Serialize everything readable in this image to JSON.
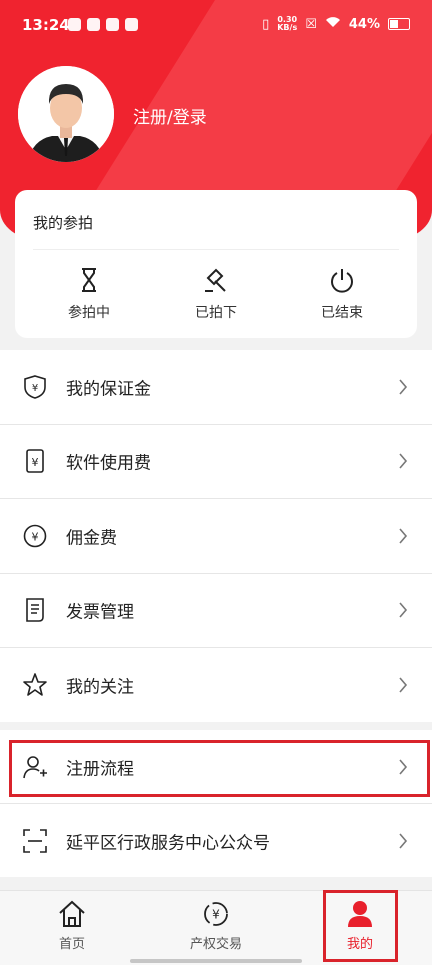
{
  "status_bar": {
    "time": "13:24",
    "speed_value": "0.30",
    "speed_unit": "KB/s",
    "battery": "44%"
  },
  "profile": {
    "login_label": "注册/登录"
  },
  "auction": {
    "title": "我的参拍",
    "items": [
      {
        "label": "参拍中",
        "icon": "hourglass-icon"
      },
      {
        "label": "已拍下",
        "icon": "gavel-icon"
      },
      {
        "label": "已结束",
        "icon": "power-icon"
      }
    ]
  },
  "menu": [
    {
      "label": "我的保证金",
      "icon": "shield-yen-icon"
    },
    {
      "label": "软件使用费",
      "icon": "phone-yen-icon"
    },
    {
      "label": "佣金费",
      "icon": "yen-circle-icon"
    },
    {
      "label": "发票管理",
      "icon": "invoice-icon"
    },
    {
      "label": "我的关注",
      "icon": "star-icon"
    }
  ],
  "menu2": [
    {
      "label": "注册流程",
      "icon": "user-add-icon"
    },
    {
      "label": "延平区行政服务中心公众号",
      "icon": "scan-icon"
    }
  ],
  "tabbar": [
    {
      "label": "首页",
      "icon": "home-icon",
      "active": false
    },
    {
      "label": "产权交易",
      "icon": "exchange-icon",
      "active": false
    },
    {
      "label": "我的",
      "icon": "profile-icon",
      "active": true
    }
  ],
  "colors": {
    "brand": "#f0232f",
    "highlight": "#d9232b"
  }
}
